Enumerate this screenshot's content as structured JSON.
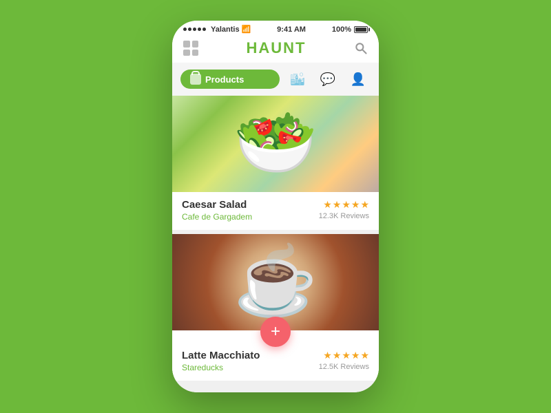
{
  "statusBar": {
    "carrier": "Yalantis",
    "time": "9:41 AM",
    "battery": "100%",
    "signal": [
      "●",
      "●",
      "●",
      "●",
      "●"
    ]
  },
  "header": {
    "title": "HAUNT",
    "gridIconLabel": "menu",
    "searchIconLabel": "search"
  },
  "navTabs": {
    "activeTab": {
      "label": "Products",
      "icon": "bag-icon"
    },
    "tabs": [
      {
        "id": "building",
        "icon": "🏙",
        "label": "Places"
      },
      {
        "id": "chat",
        "icon": "💬",
        "label": "Messages"
      },
      {
        "id": "user",
        "icon": "👤",
        "label": "Profile"
      }
    ]
  },
  "products": [
    {
      "id": "caesar-salad",
      "name": "Caesar Salad",
      "restaurant": "Cafe de Gargadem",
      "rating": 4.5,
      "reviews": "12.3K Reviews",
      "imageType": "salad"
    },
    {
      "id": "latte-macchiato",
      "name": "Latte Macchiato",
      "restaurant": "Stareducks",
      "rating": 4.5,
      "reviews": "12.5K Reviews",
      "imageType": "coffee"
    }
  ],
  "fab": {
    "label": "+"
  }
}
